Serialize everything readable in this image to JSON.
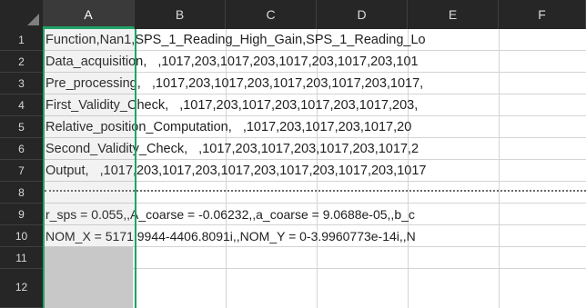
{
  "columns": [
    "A",
    "B",
    "C",
    "D",
    "E",
    "F"
  ],
  "selected_column": "A",
  "rows": [
    {
      "num": "1",
      "text": "Function,Nan1,SPS_1_Reading_High_Gain,SPS_1_Reading_Lo"
    },
    {
      "num": "2",
      "text": "Data_acquisition,   ,1017,203,1017,203,1017,203,1017,203,101"
    },
    {
      "num": "3",
      "text": "Pre_processing,   ,1017,203,1017,203,1017,203,1017,203,1017,"
    },
    {
      "num": "4",
      "text": "First_Validity_Check,   ,1017,203,1017,203,1017,203,1017,203,"
    },
    {
      "num": "5",
      "text": "Relative_position_Computation,   ,1017,203,1017,203,1017,20"
    },
    {
      "num": "6",
      "text": "Second_Validity_Check,   ,1017,203,1017,203,1017,203,1017,2"
    },
    {
      "num": "7",
      "text": "Output,   ,1017,203,1017,203,1017,203,1017,203,1017,203,1017"
    },
    {
      "num": "8",
      "text": ""
    },
    {
      "num": "9",
      "text": "r_sps = 0.055,,A_coarse = -0.06232,,a_coarse = 9.0688e-05,,b_c"
    },
    {
      "num": "10",
      "text": "NOM_X = 5171.9944-4406.8091i,,NOM_Y = 0-3.9960773e-14i,,N"
    },
    {
      "num": "11",
      "text": ""
    },
    {
      "num": "12",
      "text": ""
    }
  ]
}
